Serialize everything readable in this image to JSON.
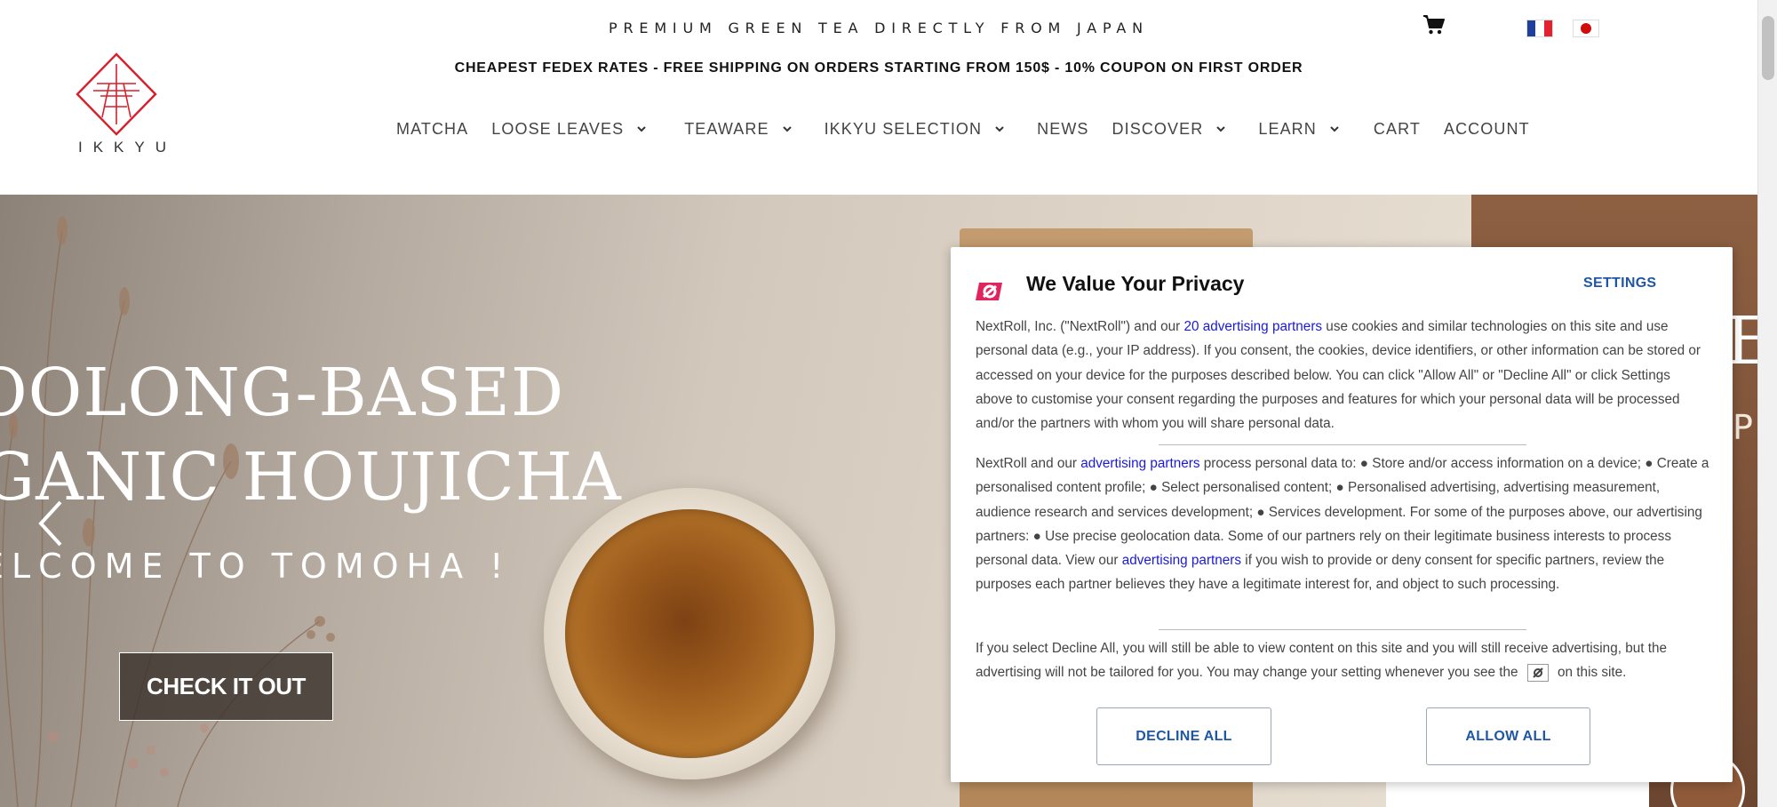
{
  "header": {
    "tagline": "PREMIUM GREEN TEA DIRECTLY FROM JAPAN",
    "promo": "CHEAPEST FEDEX RATES - FREE SHIPPING ON ORDERS STARTING FROM 150$ - 10% COUPON ON FIRST ORDER",
    "logo_text": "IKKYU",
    "cart_icon": "cart-icon",
    "languages": [
      "fr",
      "ja"
    ]
  },
  "nav": {
    "items": [
      {
        "label": "MATCHA",
        "dropdown": false
      },
      {
        "label": "LOOSE LEAVES",
        "dropdown": true
      },
      {
        "label": "TEAWARE",
        "dropdown": true
      },
      {
        "label": "IKKYU SELECTION",
        "dropdown": true
      },
      {
        "label": "NEWS",
        "dropdown": false
      },
      {
        "label": "DISCOVER",
        "dropdown": true
      },
      {
        "label": "LEARN",
        "dropdown": true
      },
      {
        "label": "CART",
        "dropdown": false
      },
      {
        "label": "ACCOUNT",
        "dropdown": false
      }
    ]
  },
  "hero": {
    "line1": "OOLONG-BASED",
    "line2": "GANIC HOUJICHA",
    "line3": "ELCOME TO TOMOHA !",
    "cta": "CHECK IT OUT",
    "next_slide_line1": "E",
    "next_slide_line2": "P"
  },
  "consent": {
    "title": "We Value Your Privacy",
    "settings": "SETTINGS",
    "p1_a": "NextRoll, Inc. (\"NextRoll\") and our ",
    "p1_link": "20 advertising partners",
    "p1_b": " use cookies and similar technologies on this site and use personal data (e.g., your IP address). If you consent, the cookies, device identifiers, or other information can be stored or accessed on your device for the purposes described below. You can click \"Allow All\" or \"Decline All\" or click Settings above to customise your consent regarding the purposes and features for which your personal data will be processed and/or the partners with whom you will share personal data.",
    "p2_a": "NextRoll and our ",
    "p2_link1": "advertising partners",
    "p2_b": " process personal data to: ● Store and/or access information on a device; ● Create a personalised content profile; ● Select personalised content; ● Personalised advertising, advertising measurement, audience research and services development; ● Services development. For some of the purposes above, our advertising partners: ● Use precise geolocation data. Some of our partners rely on their legitimate business interests to process personal data. View our ",
    "p2_link2": "advertising partners",
    "p2_c": " if you wish to provide or deny consent for specific partners, review the purposes each partner believes they have a legitimate interest for, and object to such processing.",
    "p3_a": "If you select Decline All, you will still be able to view content on this site and you will still receive advertising, but the advertising will not be tailored for you. You may change your setting whenever you see the ",
    "p3_b": " on this site.",
    "decline": "DECLINE ALL",
    "allow": "ALLOW ALL",
    "accent_color": "#1f57a4",
    "brand_color": "#e0245e"
  }
}
